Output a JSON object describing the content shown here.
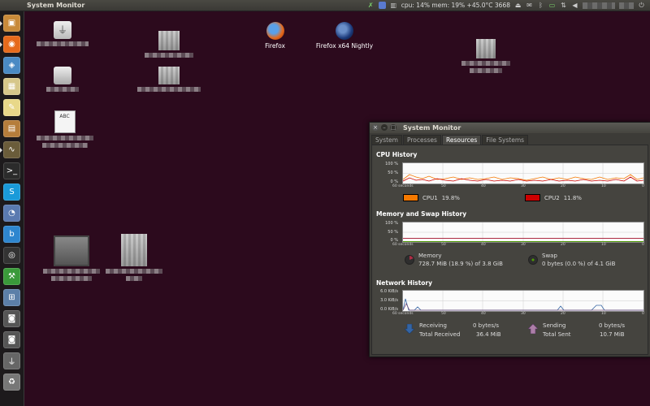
{
  "top_panel": {
    "title": "System Monitor",
    "indicator_text": "cpu: 14% mem: 19% +45.0°C 3668"
  },
  "launcher": {
    "items": [
      {
        "name": "launcher-home-folder",
        "icon": "folder-icon",
        "color": "#c88a3a",
        "glyph": "▣"
      },
      {
        "name": "launcher-firefox",
        "icon": "firefox-icon",
        "color": "#e66a1c",
        "glyph": "◉"
      },
      {
        "name": "launcher-files",
        "icon": "files-icon",
        "color": "#4a8ac4",
        "glyph": "◈"
      },
      {
        "name": "launcher-calculator",
        "icon": "calculator-icon",
        "color": "#d6c78a",
        "glyph": "▦"
      },
      {
        "name": "launcher-text-editor",
        "icon": "text-editor-icon",
        "color": "#e8d889",
        "glyph": "✎"
      },
      {
        "name": "launcher-archive",
        "icon": "archive-icon",
        "color": "#b57d3b",
        "glyph": "▤"
      },
      {
        "name": "launcher-system-monitor",
        "icon": "system-monitor-icon",
        "color": "#6a5c3a",
        "glyph": "∿"
      },
      {
        "name": "launcher-terminal",
        "icon": "terminal-icon",
        "color": "#2b2b2b",
        "glyph": ">_"
      },
      {
        "name": "launcher-skype",
        "icon": "skype-icon",
        "color": "#1a9ad9",
        "glyph": "S"
      },
      {
        "name": "launcher-pidgin",
        "icon": "chat-icon",
        "color": "#5a7ab0",
        "glyph": "◔"
      },
      {
        "name": "launcher-app-b",
        "icon": "app-b-icon",
        "color": "#2e86cf",
        "glyph": "b"
      },
      {
        "name": "launcher-camera",
        "icon": "camera-icon",
        "color": "#333",
        "glyph": "◎"
      },
      {
        "name": "launcher-utility",
        "icon": "utility-icon",
        "color": "#3a9a3a",
        "glyph": "⚒"
      },
      {
        "name": "launcher-workspaces",
        "icon": "workspace-switcher-icon",
        "color": "#5c7fa8",
        "glyph": "⊞"
      },
      {
        "name": "launcher-disk-1",
        "icon": "disk-icon",
        "color": "#555",
        "glyph": "◙"
      },
      {
        "name": "launcher-disk-2",
        "icon": "disk-icon",
        "color": "#555",
        "glyph": "◙"
      },
      {
        "name": "launcher-usb",
        "icon": "usb-drive-icon",
        "color": "#666",
        "glyph": "⏚"
      },
      {
        "name": "launcher-trash",
        "icon": "trash-icon",
        "color": "#777",
        "glyph": "♻"
      }
    ]
  },
  "desktop": {
    "firefox_label": "Firefox",
    "nightly_label": "Firefox x64 Nightly"
  },
  "window": {
    "title": "System Monitor",
    "tabs": [
      "System",
      "Processes",
      "Resources",
      "File Systems"
    ],
    "active_tab": "Resources",
    "cpu": {
      "title": "CPU History",
      "y_ticks": [
        "100 %",
        "50 %",
        "0 %"
      ],
      "x_ticks": [
        "60 seconds",
        "50",
        "40",
        "30",
        "20",
        "10",
        "0"
      ],
      "cpu1_label": "CPU1",
      "cpu1_value": "19.8%",
      "cpu1_color": "#f57900",
      "cpu2_label": "CPU2",
      "cpu2_value": "11.8%",
      "cpu2_color": "#cc0000"
    },
    "memory": {
      "title": "Memory and Swap History",
      "y_ticks": [
        "100 %",
        "50 %",
        "0 %"
      ],
      "x_ticks": [
        "60 seconds",
        "50",
        "40",
        "30",
        "20",
        "10",
        "0"
      ],
      "memory_label": "Memory",
      "memory_value": "728.7 MiB (18.9 %) of 3.8 GiB",
      "memory_color": "#ad2c44",
      "swap_label": "Swap",
      "swap_value": "0 bytes (0.0 %) of 4.1 GiB",
      "swap_color": "#4e9a06"
    },
    "network": {
      "title": "Network History",
      "y_ticks": [
        "6.0 KiB/s",
        "3.0 KiB/s",
        "0.0 KiB/s"
      ],
      "x_ticks": [
        "60 seconds",
        "50",
        "40",
        "30",
        "20",
        "10",
        "0"
      ],
      "receiving_label": "Receiving",
      "receiving_rate": "0 bytes/s",
      "total_received_label": "Total Received",
      "total_received": "36.4 MiB",
      "sending_label": "Sending",
      "sending_rate": "0 bytes/s",
      "total_sent_label": "Total Sent",
      "total_sent": "10.7 MiB",
      "receiving_color": "#3465a4",
      "sending_color": "#75507b"
    }
  }
}
